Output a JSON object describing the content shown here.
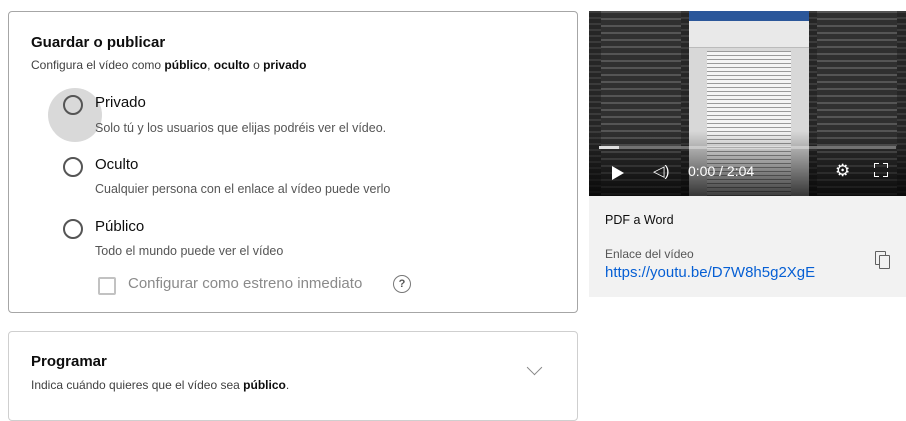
{
  "save_publish": {
    "title": "Guardar o publicar",
    "subtitle_prefix": "Configura el vídeo como ",
    "subtitle_public": "público",
    "subtitle_sep1": ", ",
    "subtitle_hidden": "oculto",
    "subtitle_sep2": " o ",
    "subtitle_private": "privado",
    "options": [
      {
        "label": "Privado",
        "description": "Solo tú y los usuarios que elijas podréis ver el vídeo.",
        "selected": false
      },
      {
        "label": "Oculto",
        "description": "Cualquier persona con el enlace al vídeo puede verlo",
        "selected": false
      },
      {
        "label": "Público",
        "description": "Todo el mundo puede ver el vídeo",
        "selected": false
      }
    ],
    "premiere_label": "Configurar como estreno inmediato",
    "premiere_checked": false,
    "help_glyph": "?"
  },
  "schedule": {
    "title": "Programar",
    "subtitle_prefix": "Indica cuándo quieres que el vídeo sea ",
    "subtitle_bold": "público",
    "subtitle_suffix": "."
  },
  "video": {
    "time": "0:00 / 2:04",
    "progress_fraction": 0.0,
    "name": "PDF a Word",
    "link_label": "Enlace del vídeo",
    "link": "https://youtu.be/D7W8h5g2XgE",
    "icons": [
      "play-icon",
      "volume-icon",
      "settings-icon",
      "fullscreen-icon",
      "copy-icon"
    ]
  },
  "colors": {
    "link": "#065fd4",
    "border": "#a6a6a6",
    "panel_bg": "#f2f2f2"
  }
}
